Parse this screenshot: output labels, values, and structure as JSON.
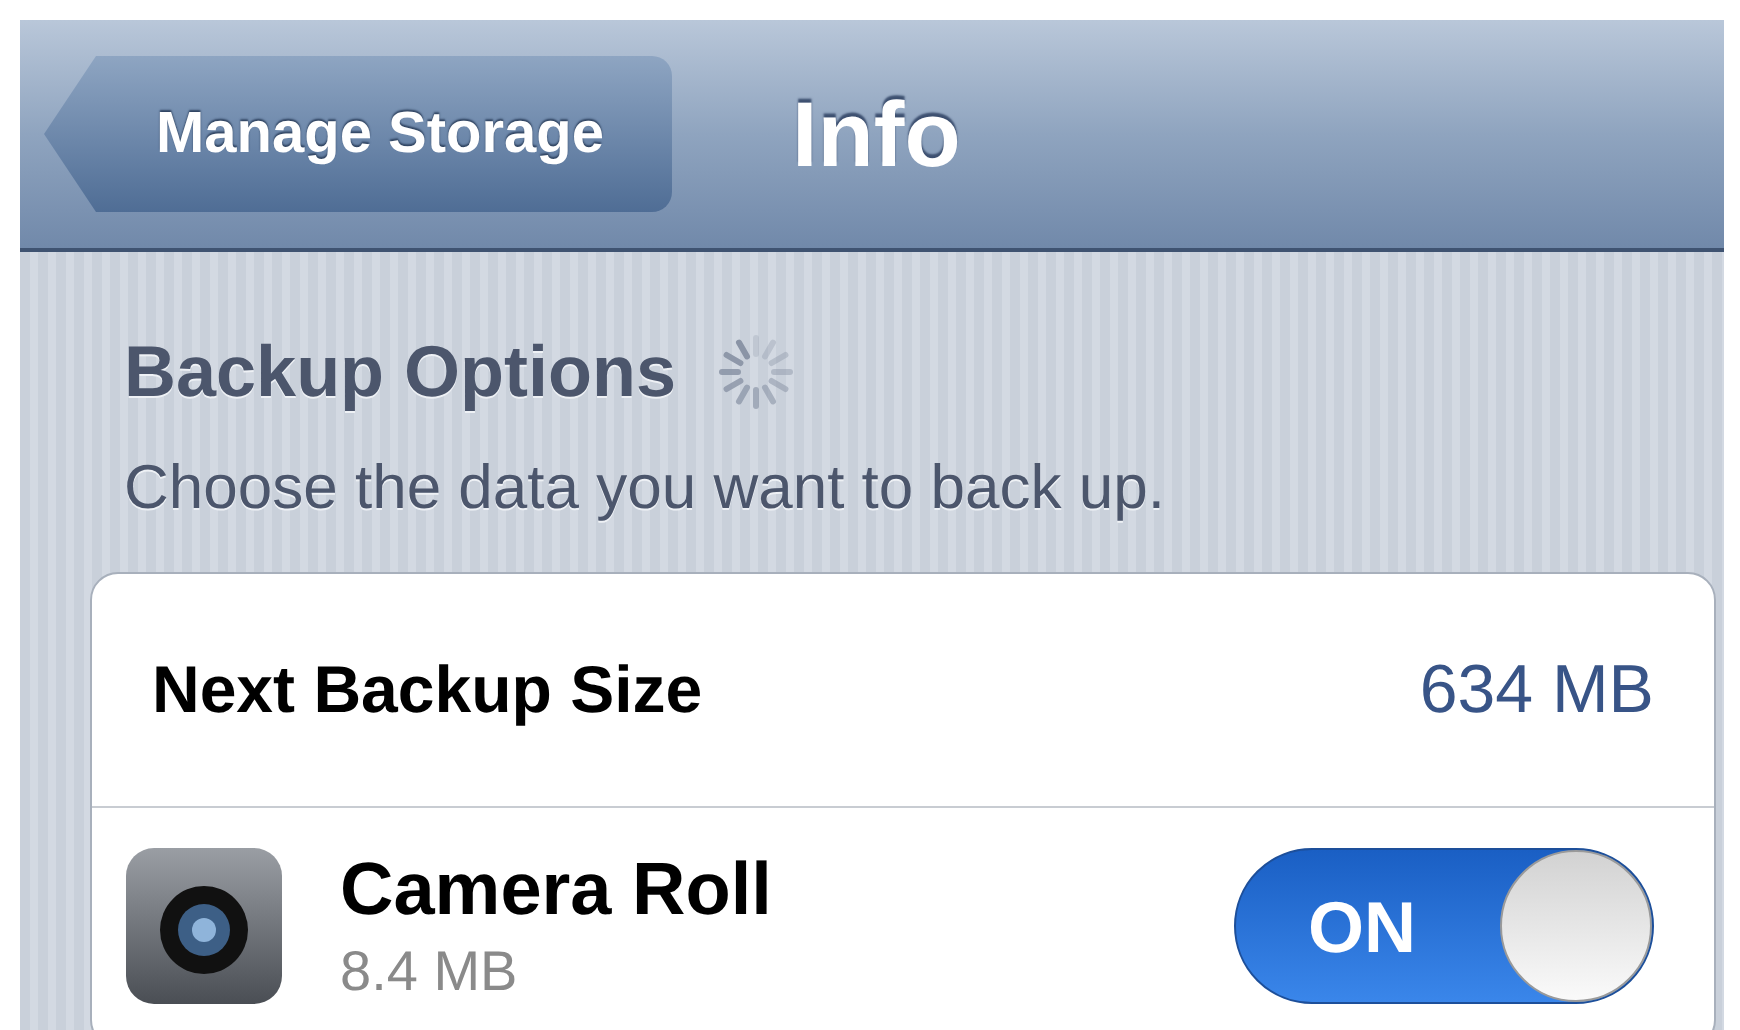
{
  "navigation_bar": {
    "back_button": "Manage Storage",
    "title": "Info"
  },
  "section": {
    "title": "Backup Options",
    "loading": true,
    "subtitle": "Choose the data you want to back up."
  },
  "rows": [
    {
      "kind": "value",
      "label": "Next Backup Size",
      "value": "634 MB"
    },
    {
      "kind": "toggle",
      "label": "Camera Roll",
      "detail": "8.4 MB",
      "on": true,
      "toggle_label": "ON"
    }
  ]
}
